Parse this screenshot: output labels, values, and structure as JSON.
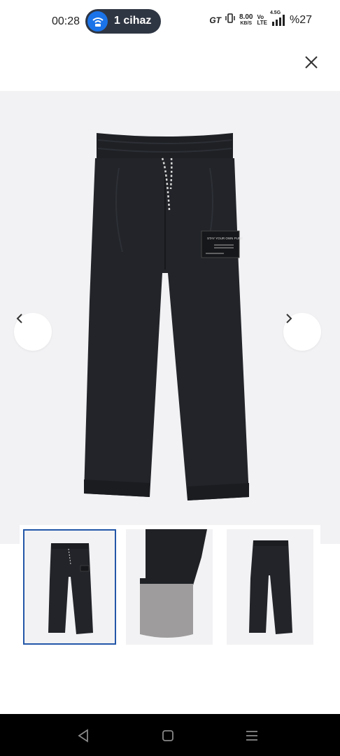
{
  "status_bar": {
    "time": "00:28",
    "hotspot_label": "1 cihaz",
    "network_badge": "GT",
    "speed_value": "8.00",
    "speed_unit": "KB/S",
    "volte_top": "Vo",
    "volte_bottom": "LTE",
    "signal_type": "4.5G",
    "battery": "%27"
  },
  "product_image": {
    "patch_text": "STAY YOUR OWN PURE",
    "alt": "black trousers"
  },
  "thumbnails": [
    {
      "name": "thumbnail-front",
      "active": true
    },
    {
      "name": "thumbnail-cuff-detail",
      "active": false
    },
    {
      "name": "thumbnail-back",
      "active": false
    }
  ],
  "icons": {
    "close": "close-icon",
    "prev": "chevron-left-icon",
    "next": "chevron-right-icon",
    "back": "back-triangle-icon",
    "home": "home-square-icon",
    "menu": "menu-lines-icon"
  },
  "colors": {
    "pill_bg": "#2f3643",
    "wifi_blue": "#1a73e8",
    "active_border": "#2357a8",
    "image_bg": "#f2f2f4",
    "pants": "#222429"
  }
}
